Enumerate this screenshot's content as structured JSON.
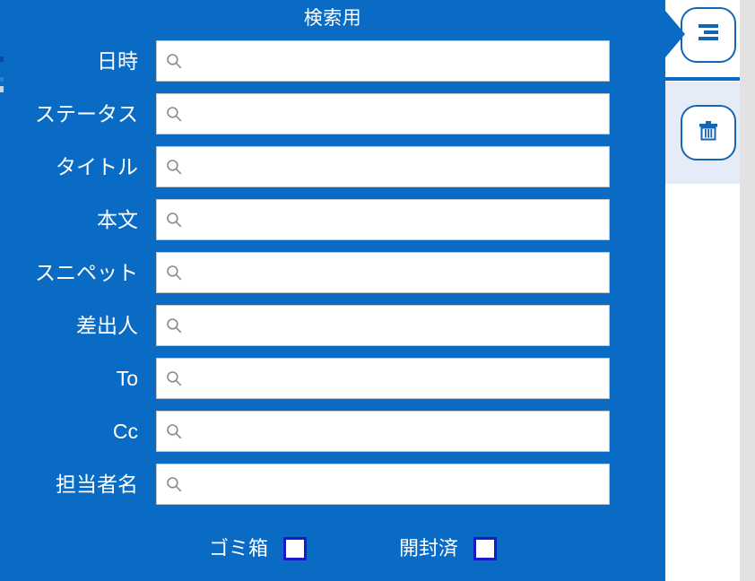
{
  "theme": {
    "panel_blue": "#0a6bc4",
    "icon_blue": "#1565b5",
    "rail_tint": "#e6ecf7",
    "checkbox_border": "#1a1ac8",
    "field_background": "#ffffff",
    "field_border": "#c4c4c4",
    "label_color": "#ffffff"
  },
  "panel": {
    "title": "検索用"
  },
  "rail": {
    "menu_icon": "align-right-icon",
    "menu_label": "メニュー",
    "trash_icon": "trash-icon",
    "trash_label": "ゴミ箱"
  },
  "form": {
    "search_icon": "search-icon",
    "rows": [
      {
        "label": "日時",
        "name": "datetime",
        "value": "",
        "placeholder": ""
      },
      {
        "label": "ステータス",
        "name": "status",
        "value": "",
        "placeholder": ""
      },
      {
        "label": "タイトル",
        "name": "title",
        "value": "",
        "placeholder": ""
      },
      {
        "label": "本文",
        "name": "body",
        "value": "",
        "placeholder": ""
      },
      {
        "label": "スニペット",
        "name": "snippet",
        "value": "",
        "placeholder": ""
      },
      {
        "label": "差出人",
        "name": "sender",
        "value": "",
        "placeholder": ""
      },
      {
        "label": "To",
        "name": "to",
        "value": "",
        "placeholder": ""
      },
      {
        "label": "Cc",
        "name": "cc",
        "value": "",
        "placeholder": ""
      },
      {
        "label": "担当者名",
        "name": "assignee",
        "value": "",
        "placeholder": ""
      }
    ]
  },
  "checkboxes": [
    {
      "label": "ゴミ箱",
      "name": "trash",
      "checked": false
    },
    {
      "label": "開封済",
      "name": "opened",
      "checked": false
    }
  ]
}
